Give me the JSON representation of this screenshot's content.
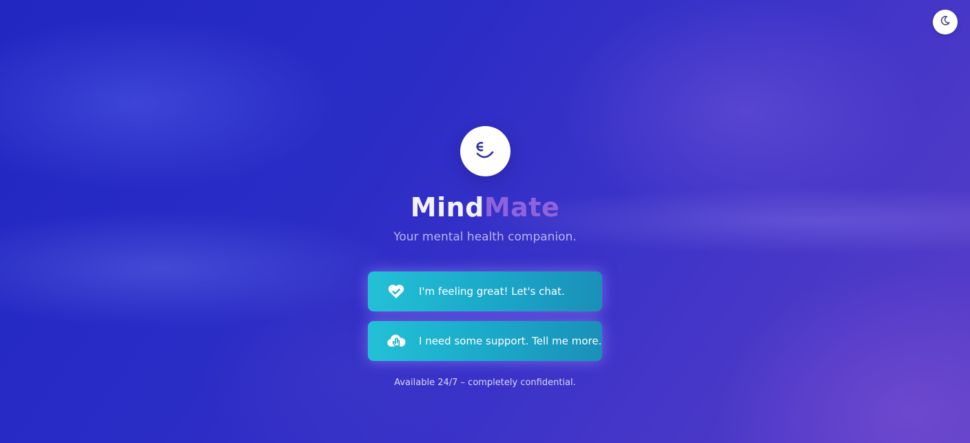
{
  "theme_toggle": {
    "icon": "moon-icon"
  },
  "brand": {
    "logo_icon": "winking-smile-icon",
    "name_part1": "Mind",
    "name_part2": "Mate",
    "tagline": "Your mental health companion."
  },
  "actions": [
    {
      "icon": "heart-check-icon",
      "label": "I'm feeling great! Let's chat."
    },
    {
      "icon": "cloud-hand-icon",
      "label": "I need some support. Tell me more."
    }
  ],
  "footnote": "Available 24/7 – completely confidential.",
  "colors": {
    "background_start": "#2227c2",
    "background_end": "#5a3ec8",
    "brand_accent": "#8f63dc",
    "button_teal": "#22c1d6"
  }
}
